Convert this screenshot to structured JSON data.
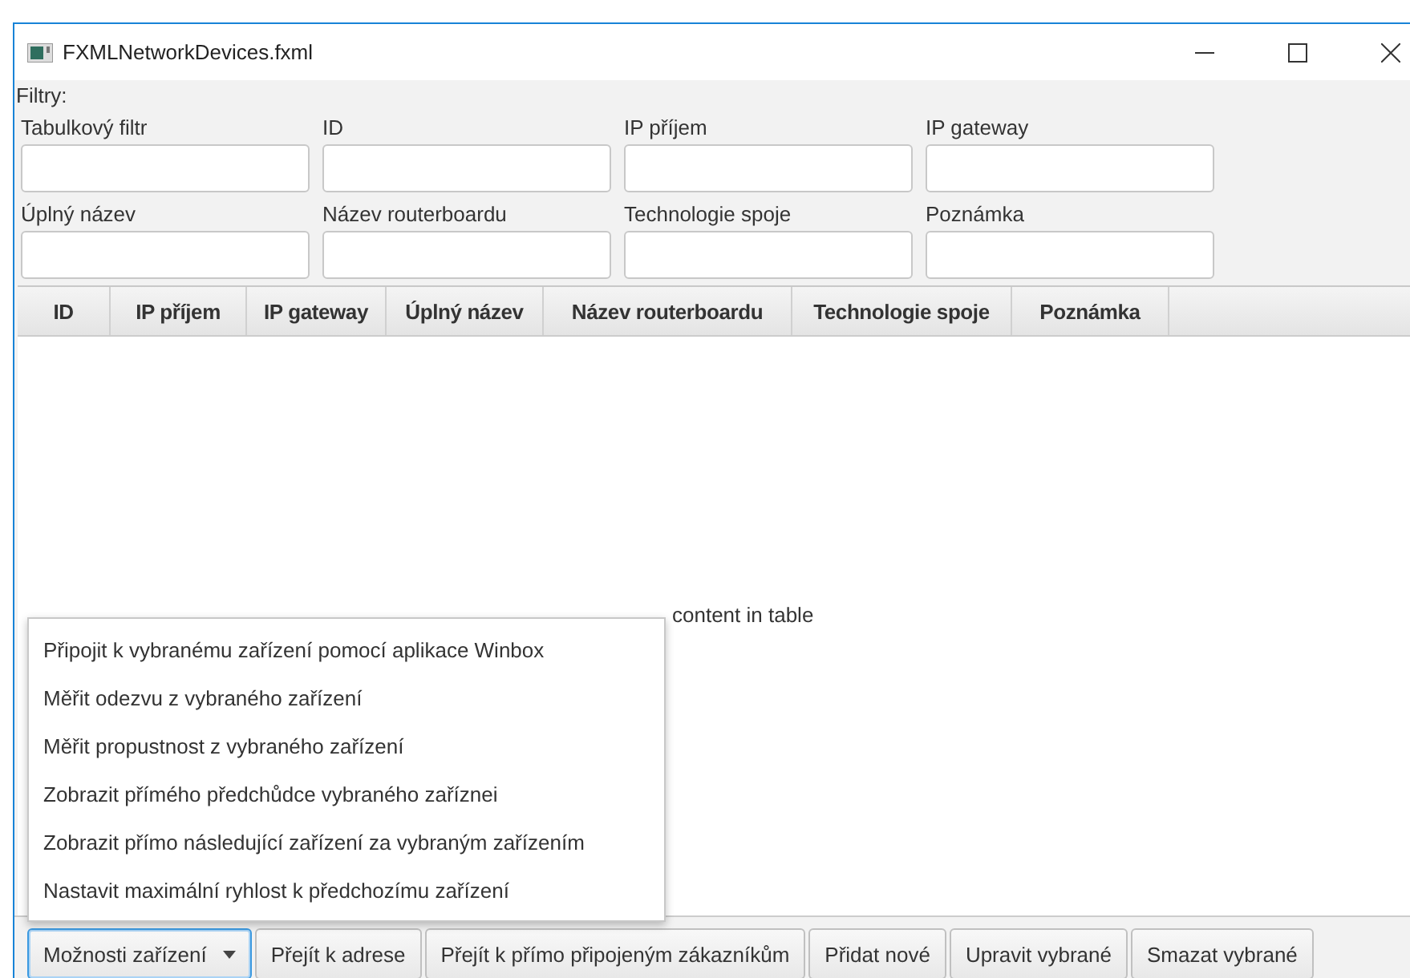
{
  "window": {
    "title": "FXMLNetworkDevices.fxml"
  },
  "filters": {
    "heading": "Filtry:",
    "fields": [
      {
        "label": "Tabulkový filtr"
      },
      {
        "label": "ID"
      },
      {
        "label": "IP příjem"
      },
      {
        "label": "IP gateway"
      },
      {
        "label": "Úplný název"
      },
      {
        "label": "Název routerboardu"
      },
      {
        "label": "Technologie spoje"
      },
      {
        "label": "Poznámka"
      }
    ]
  },
  "table": {
    "columns": [
      "ID",
      "IP příjem",
      "IP gateway",
      "Úplný název",
      "Název routerboardu",
      "Technologie spoje",
      "Poznámka"
    ],
    "placeholder": "content in table"
  },
  "menu": {
    "items": [
      "Připojit k vybranému zařízení pomocí aplikace Winbox",
      "Měřit odezvu z vybraného zařízení",
      "Měřit propustnost z vybraného zařízení",
      "Zobrazit přímého předchůdce vybraného zaříznei",
      "Zobrazit  přímo následující zařízení za vybraným zařízením",
      "Nastavit maximální ryhlost k předchozímu zařízení"
    ]
  },
  "buttons": [
    {
      "label": "Možnosti zařízení",
      "kind": "menu",
      "focused": true
    },
    {
      "label": "Přejít k adrese",
      "kind": "plain",
      "focused": false
    },
    {
      "label": "Přejít k přímo připojeným zákazníkům",
      "kind": "plain",
      "focused": false
    },
    {
      "label": "Přidat nové",
      "kind": "plain",
      "focused": false
    },
    {
      "label": "Upravit vybrané",
      "kind": "plain",
      "focused": false
    },
    {
      "label": "Smazat vybrané",
      "kind": "plain",
      "focused": false
    }
  ]
}
